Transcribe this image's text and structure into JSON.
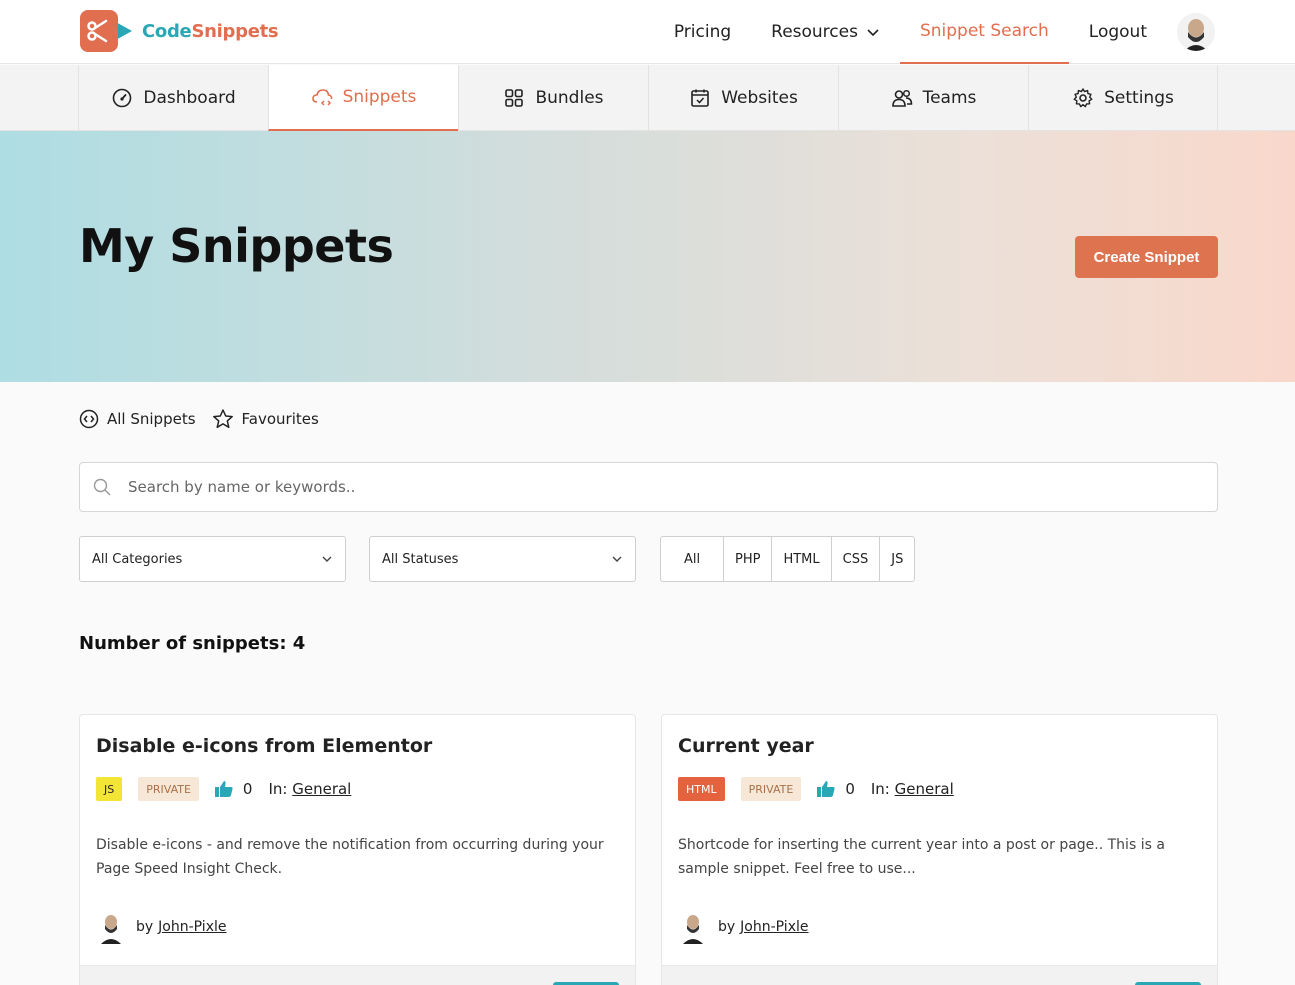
{
  "brand": {
    "name_part1": "Code",
    "name_part2": "Snippets",
    "primary_color": "#e06e4f",
    "secondary_color": "#2aa7b4"
  },
  "topnav": {
    "items": [
      {
        "label": "Pricing"
      },
      {
        "label": "Resources"
      },
      {
        "label": "Snippet Search",
        "active": true
      },
      {
        "label": "Logout"
      }
    ]
  },
  "tabs": [
    {
      "label": "Dashboard",
      "icon": "dashboard-gauge-icon"
    },
    {
      "label": "Snippets",
      "icon": "cloud-code-icon",
      "active": true
    },
    {
      "label": "Bundles",
      "icon": "grid-icon"
    },
    {
      "label": "Websites",
      "icon": "browser-window-icon"
    },
    {
      "label": "Teams",
      "icon": "users-icon"
    },
    {
      "label": "Settings",
      "icon": "gear-icon"
    }
  ],
  "hero": {
    "title": "My Snippets",
    "create_label": "Create Snippet"
  },
  "views": {
    "all_label": "All Snippets",
    "favourites_label": "Favourites"
  },
  "search": {
    "placeholder": "Search by name or keywords.."
  },
  "filters": {
    "category_selected": "All Categories",
    "status_selected": "All Statuses",
    "languages": [
      "All",
      "PHP",
      "HTML",
      "CSS",
      "JS"
    ]
  },
  "count_label": "Number of snippets: 4",
  "cards": [
    {
      "title": "Disable e-icons from Elementor",
      "language": "JS",
      "visibility": "PRIVATE",
      "likes": "0",
      "in_label": "In:",
      "category": "General",
      "description": "Disable e-icons - and remove the notification from occurring during your Page Speed Insight Check.",
      "by_label": "by",
      "author": "John-Pixle"
    },
    {
      "title": "Current year",
      "language": "HTML",
      "visibility": "PRIVATE",
      "likes": "0",
      "in_label": "In:",
      "category": "General",
      "description": "Shortcode for inserting the current year into a post or page.. This is a sample snippet. Feel free to use...",
      "by_label": "by",
      "author": "John-Pixle"
    }
  ]
}
